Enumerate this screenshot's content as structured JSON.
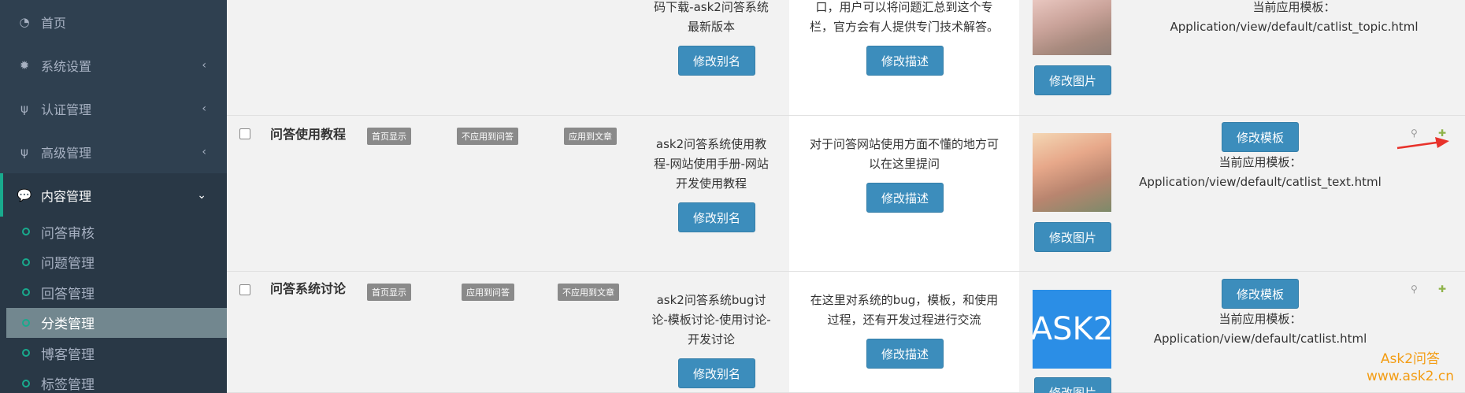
{
  "sidebar": {
    "items": [
      {
        "label": "首页",
        "icon": "dashboard-icon"
      },
      {
        "label": "系统设置",
        "icon": "gear-icon"
      },
      {
        "label": "认证管理",
        "icon": "fork-icon"
      },
      {
        "label": "高级管理",
        "icon": "fork-icon"
      },
      {
        "label": "内容管理",
        "icon": "chat-icon"
      }
    ],
    "submenu": [
      {
        "label": "问答审核"
      },
      {
        "label": "问题管理"
      },
      {
        "label": "回答管理"
      },
      {
        "label": "分类管理"
      },
      {
        "label": "博客管理"
      },
      {
        "label": "标签管理"
      }
    ]
  },
  "rows": [
    {
      "alias_text": [
        "码下载-ask2问答系统",
        "最新版本"
      ],
      "alias_button": "修改别名",
      "desc_text": [
        "口，用户可以将问题汇总到这个专",
        "栏，官方会有人提供专门技术解答。"
      ],
      "desc_button": "修改描述",
      "image_button": "修改图片",
      "template_label": "当前应用模板：",
      "template_path": "Application/view/default/catlist_topic.html"
    },
    {
      "name": "问答使用教程",
      "badges": [
        "首页显示",
        "不应用到问答",
        "应用到文章"
      ],
      "alias_text": [
        "ask2问答系统使用教",
        "程-网站使用手册-网站",
        "开发使用教程"
      ],
      "alias_button": "修改别名",
      "desc_text": [
        "对于问答网站使用方面不懂的地方可",
        "以在这里提问"
      ],
      "desc_button": "修改描述",
      "image_button": "修改图片",
      "template_button": "修改模板",
      "template_label": "当前应用模板：",
      "template_path": "Application/view/default/catlist_text.html"
    },
    {
      "name": "问答系统讨论",
      "badges": [
        "首页显示",
        "应用到问答",
        "不应用到文章"
      ],
      "alias_text": [
        "ask2问答系统bug讨",
        "论-模板讨论-使用讨论-",
        "开发讨论"
      ],
      "alias_button": "修改别名",
      "desc_text": [
        "在这里对系统的bug，模板，和使用",
        "过程，还有开发过程进行交流"
      ],
      "desc_button": "修改描述",
      "image_text": "ASK2",
      "image_button": "修改图片",
      "template_button": "修改模板",
      "template_label": "当前应用模板：",
      "template_path": "Application/view/default/catlist.html"
    }
  ],
  "watermark": {
    "line1": "Ask2问答",
    "line2": "www.ask2.cn"
  },
  "colors": {
    "sidebar_bg": "#2f4050",
    "accent": "#19aa8d",
    "button": "#3c8dbc",
    "watermark": "#f39c12",
    "arrow": "#e8322b"
  }
}
